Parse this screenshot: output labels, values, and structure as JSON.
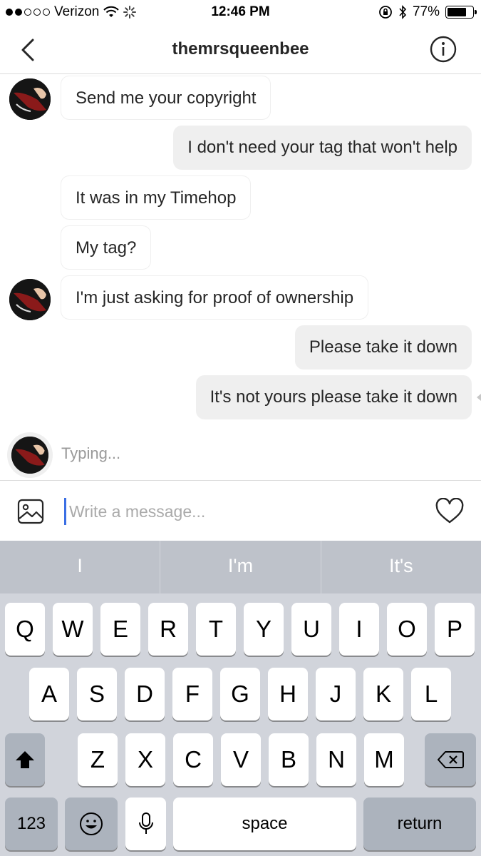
{
  "status_bar": {
    "carrier": "Verizon",
    "time": "12:46 PM",
    "battery": "77%",
    "battery_level": 0.77,
    "icons": [
      "signal-dots-icon",
      "wifi-icon",
      "activity-spinner-icon",
      "orientation-lock-icon",
      "bluetooth-icon",
      "battery-icon"
    ]
  },
  "header": {
    "title": "themrsqueenbee",
    "icons": [
      "back-chevron-icon",
      "info-icon"
    ]
  },
  "messages": [
    {
      "direction": "in",
      "text": "Send me your copyright",
      "avatar": true
    },
    {
      "direction": "out",
      "text": "I don't need your tag that won't help"
    },
    {
      "direction": "in",
      "text": "It was in my Timehop",
      "avatar": false
    },
    {
      "direction": "in",
      "text": "My tag?",
      "avatar": false
    },
    {
      "direction": "in",
      "text": "I'm just asking for proof of ownership",
      "avatar": true
    },
    {
      "direction": "out",
      "text": "Please take it down"
    },
    {
      "direction": "out",
      "text": "It's not yours please take it down"
    }
  ],
  "typing_indicator": "Typing...",
  "composer": {
    "placeholder": "Write a message...",
    "icons": [
      "gallery-icon",
      "heart-icon"
    ]
  },
  "keyboard": {
    "suggestions": [
      "I",
      "I'm",
      "It's"
    ],
    "row1": [
      "Q",
      "W",
      "E",
      "R",
      "T",
      "Y",
      "U",
      "I",
      "O",
      "P"
    ],
    "row2": [
      "A",
      "S",
      "D",
      "F",
      "G",
      "H",
      "J",
      "K",
      "L"
    ],
    "row3": [
      "Z",
      "X",
      "C",
      "V",
      "B",
      "N",
      "M"
    ],
    "numbers_key": "123",
    "space_key": "space",
    "return_key": "return",
    "icons": [
      "shift-icon",
      "backspace-icon",
      "emoji-icon",
      "microphone-icon"
    ]
  }
}
